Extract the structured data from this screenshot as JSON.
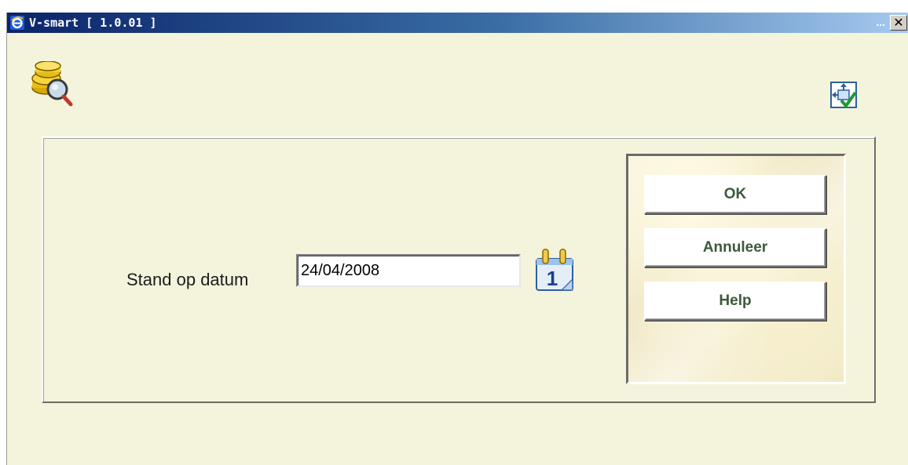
{
  "window": {
    "title": "V-smart [ 1.0.01 ]",
    "title_dots": "...",
    "close_symbol": "✕"
  },
  "icons": {
    "app": "ie-icon",
    "module": "coins-search-icon",
    "maximize": "maximize-check-icon",
    "calendar": "calendar-icon"
  },
  "form": {
    "label": "Stand op datum",
    "date_value": "24/04/2008",
    "calendar_day": "1"
  },
  "buttons": {
    "ok": "OK",
    "cancel": "Annuleer",
    "help": "Help"
  },
  "colors": {
    "background": "#f4f4dc",
    "button_text": "#3b5a3a",
    "title_start": "#0a246a",
    "title_end": "#a6caf0"
  }
}
